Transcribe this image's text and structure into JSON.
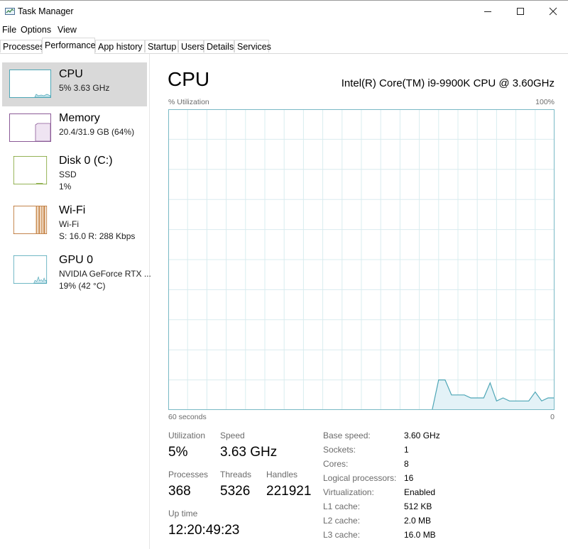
{
  "window": {
    "title": "Task Manager"
  },
  "menu": [
    "File",
    "Options",
    "View"
  ],
  "tabs": [
    {
      "label": "Processes"
    },
    {
      "label": "Performance",
      "active": true
    },
    {
      "label": "App history"
    },
    {
      "label": "Startup"
    },
    {
      "label": "Users"
    },
    {
      "label": "Details"
    },
    {
      "label": "Services"
    }
  ],
  "sidebar": {
    "items": [
      {
        "title": "CPU",
        "lines": [
          "5% 3.63 GHz"
        ],
        "active": true
      },
      {
        "title": "Memory",
        "lines": [
          "20.4/31.9 GB (64%)"
        ]
      },
      {
        "title": "Disk 0 (C:)",
        "lines": [
          "SSD",
          "1%"
        ]
      },
      {
        "title": "Wi-Fi",
        "lines": [
          "Wi-Fi",
          "S: 16.0 R: 288 Kbps"
        ]
      },
      {
        "title": "GPU 0",
        "lines": [
          "NVIDIA GeForce RTX ...",
          "19% (42 °C)"
        ]
      }
    ]
  },
  "main": {
    "title": "CPU",
    "model": "Intel(R) Core(TM) i9-9900K CPU @ 3.60GHz",
    "graph": {
      "y_label": "% Utilization",
      "y_max_label": "100%",
      "x_left_label": "60 seconds",
      "x_right_label": "0"
    },
    "stats": {
      "utilization_label": "Utilization",
      "utilization": "5%",
      "speed_label": "Speed",
      "speed": "3.63 GHz",
      "processes_label": "Processes",
      "processes": "368",
      "threads_label": "Threads",
      "threads": "5326",
      "handles_label": "Handles",
      "handles": "221921",
      "uptime_label": "Up time",
      "uptime": "12:20:49:23"
    },
    "specs": [
      {
        "label": "Base speed:",
        "value": "3.60 GHz"
      },
      {
        "label": "Sockets:",
        "value": "1"
      },
      {
        "label": "Cores:",
        "value": "8"
      },
      {
        "label": "Logical processors:",
        "value": "16"
      },
      {
        "label": "Virtualization:",
        "value": "Enabled"
      },
      {
        "label": "L1 cache:",
        "value": "512 KB"
      },
      {
        "label": "L2 cache:",
        "value": "2.0 MB"
      },
      {
        "label": "L3 cache:",
        "value": "16.0 MB"
      }
    ]
  },
  "chart_data": {
    "type": "area",
    "x_range_seconds": [
      60,
      0
    ],
    "ylim": [
      0,
      100
    ],
    "grid": true,
    "series": [
      {
        "x": [
          60,
          59,
          58,
          57,
          56,
          55,
          54,
          53,
          52,
          51,
          50,
          49,
          48,
          47,
          46,
          45,
          44,
          43,
          42,
          41,
          40,
          39,
          38,
          37,
          36,
          35,
          34,
          33,
          32,
          31,
          30,
          29,
          28,
          27,
          26,
          25,
          24,
          23,
          22,
          21,
          20,
          19,
          18,
          17,
          16,
          15,
          14,
          13,
          12,
          11,
          10,
          9,
          8,
          7,
          6,
          5,
          4,
          3,
          2,
          1,
          0
        ],
        "values": [
          0,
          0,
          0,
          0,
          0,
          0,
          0,
          0,
          0,
          0,
          0,
          0,
          0,
          0,
          0,
          0,
          0,
          0,
          0,
          0,
          0,
          0,
          0,
          0,
          0,
          0,
          0,
          0,
          0,
          0,
          0,
          0,
          0,
          0,
          0,
          0,
          0,
          0,
          0,
          0,
          0,
          0,
          10,
          10,
          5,
          5,
          5,
          4,
          4,
          4,
          9,
          3,
          4,
          3,
          3,
          3,
          3,
          6,
          3,
          4,
          4
        ]
      }
    ],
    "colors": {
      "line": "#4ea6b6",
      "fill": "#e3f2f7",
      "grid": "#d9ecef",
      "border": "#79b9c5"
    }
  }
}
